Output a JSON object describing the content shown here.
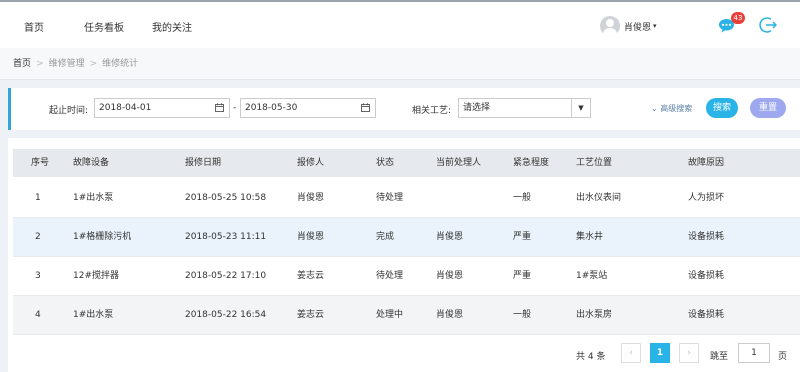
{
  "nav": {
    "items": [
      {
        "label": "首页"
      },
      {
        "label": "任务看板"
      },
      {
        "label": "我的关注"
      }
    ],
    "user": {
      "name": "肖俊恩",
      "caret": "▾"
    },
    "notifications": {
      "count": "43"
    },
    "accent_color": "#29b3e6"
  },
  "breadcrumb": {
    "items": [
      "首页",
      "维修管理",
      "维修统计"
    ],
    "separator": ">"
  },
  "filter": {
    "date_label": "起止时间:",
    "start_date": "2018-04-01",
    "dash": "-",
    "end_date": "2018-05-30",
    "process_label": "相关工艺:",
    "process_value": "请选择",
    "advanced_label": "高级搜索",
    "advanced_chevron": "chevron-down-icon",
    "search_label": "搜索",
    "reset_label": "重置"
  },
  "table": {
    "headers": [
      "序号",
      "故障设备",
      "报修日期",
      "报修人",
      "状态",
      "当前处理人",
      "紧急程度",
      "工艺位置",
      "故障原因"
    ],
    "rows": [
      [
        "1",
        "1#出水泵",
        "2018-05-25 10:58",
        "肖俊恩",
        "待处理",
        "",
        "一般",
        "出水仪表间",
        "人为损坏"
      ],
      [
        "2",
        "1#格栅除污机",
        "2018-05-23 11:11",
        "肖俊恩",
        "完成",
        "肖俊恩",
        "严重",
        "集水井",
        "设备损耗"
      ],
      [
        "3",
        "12#搅拌器",
        "2018-05-22 17:10",
        "姜志云",
        "待处理",
        "肖俊恩",
        "严重",
        "1#泵站",
        "设备损耗"
      ],
      [
        "4",
        "1#出水泵",
        "2018-05-22 16:54",
        "姜志云",
        "处理中",
        "肖俊恩",
        "一般",
        "出水泵房",
        "设备损耗"
      ]
    ]
  },
  "pagination": {
    "total": "共 4 条",
    "prev": "‹",
    "page": "1",
    "next": "›",
    "jump_label": "跳至",
    "jump_value": "1",
    "page_unit": "页"
  }
}
